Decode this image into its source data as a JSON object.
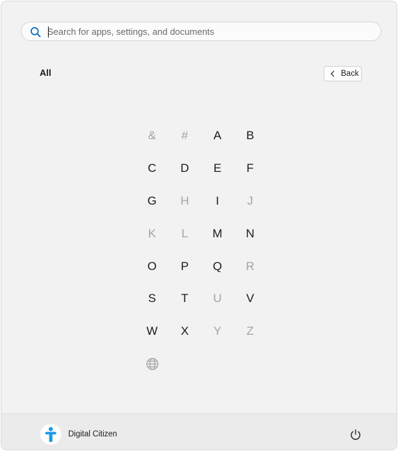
{
  "search": {
    "placeholder": "Search for apps, settings, and documents",
    "icon": "search-icon"
  },
  "main": {
    "section_title": "All",
    "back_label": "Back"
  },
  "letters": [
    {
      "label": "&",
      "enabled": false
    },
    {
      "label": "#",
      "enabled": false
    },
    {
      "label": "A",
      "enabled": true
    },
    {
      "label": "B",
      "enabled": true
    },
    {
      "label": "C",
      "enabled": true
    },
    {
      "label": "D",
      "enabled": true
    },
    {
      "label": "E",
      "enabled": true
    },
    {
      "label": "F",
      "enabled": true
    },
    {
      "label": "G",
      "enabled": true
    },
    {
      "label": "H",
      "enabled": false
    },
    {
      "label": "I",
      "enabled": true
    },
    {
      "label": "J",
      "enabled": false
    },
    {
      "label": "K",
      "enabled": false
    },
    {
      "label": "L",
      "enabled": false
    },
    {
      "label": "M",
      "enabled": true
    },
    {
      "label": "N",
      "enabled": true
    },
    {
      "label": "O",
      "enabled": true
    },
    {
      "label": "P",
      "enabled": true
    },
    {
      "label": "Q",
      "enabled": true
    },
    {
      "label": "R",
      "enabled": false
    },
    {
      "label": "S",
      "enabled": true
    },
    {
      "label": "T",
      "enabled": true
    },
    {
      "label": "U",
      "enabled": false
    },
    {
      "label": "V",
      "enabled": true
    },
    {
      "label": "W",
      "enabled": true
    },
    {
      "label": "X",
      "enabled": true
    },
    {
      "label": "Y",
      "enabled": false
    },
    {
      "label": "Z",
      "enabled": false
    },
    {
      "label": "",
      "icon": "globe-icon",
      "enabled": false
    }
  ],
  "footer": {
    "user_name": "Digital Citizen",
    "avatar_icon": "accessibility-figure-icon",
    "power_icon": "power-icon"
  },
  "colors": {
    "panel_bg": "#f2f2f2",
    "accent": "#0067c0",
    "avatar_figure": "#1a9be6",
    "enabled_text": "#1b1b1b",
    "disabled_text": "#a3a3a3"
  }
}
